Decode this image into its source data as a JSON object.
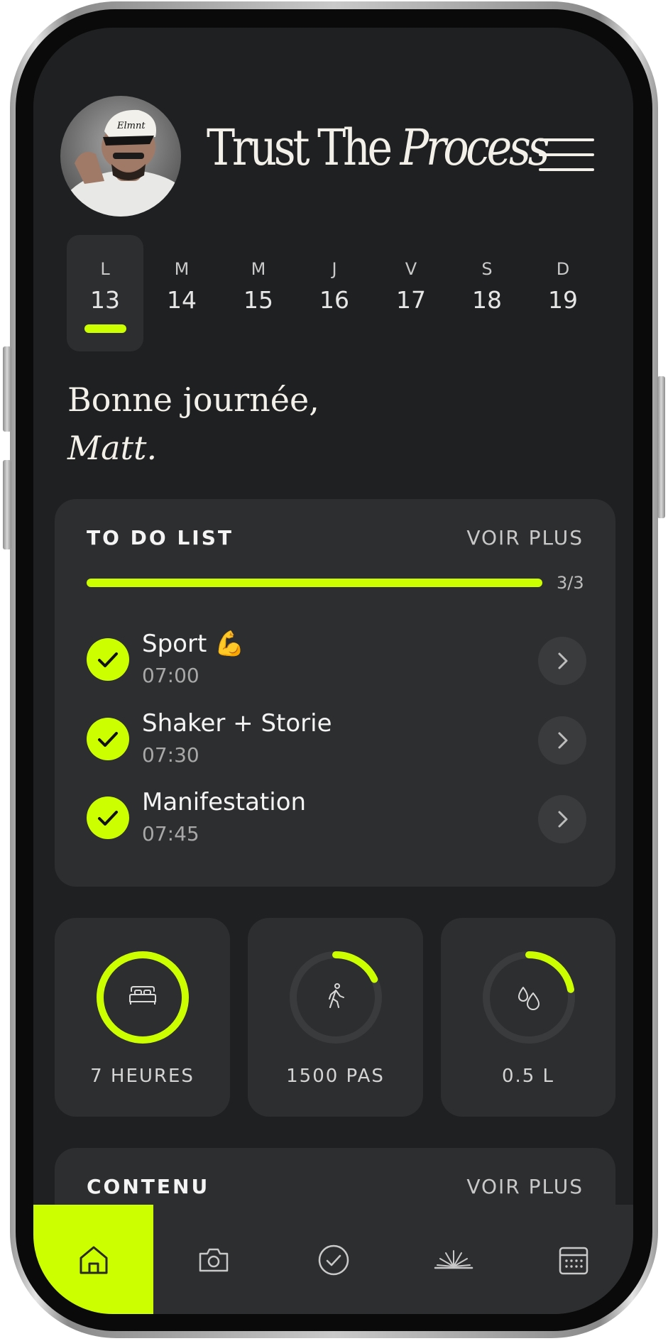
{
  "header": {
    "title_regular": "Trust The",
    "title_italic": "Process"
  },
  "calendar": {
    "days": [
      {
        "letter": "L",
        "number": "13",
        "selected": true
      },
      {
        "letter": "M",
        "number": "14"
      },
      {
        "letter": "M",
        "number": "15"
      },
      {
        "letter": "J",
        "number": "16"
      },
      {
        "letter": "V",
        "number": "17"
      },
      {
        "letter": "S",
        "number": "18"
      },
      {
        "letter": "D",
        "number": "19"
      }
    ]
  },
  "greeting": {
    "line1": "Bonne journée,",
    "name": "Matt."
  },
  "todo": {
    "title": "TO DO LIST",
    "see_more": "VOIR PLUS",
    "progress_fraction": 1.0,
    "progress_label": "3/3",
    "tasks": [
      {
        "name": "Sport 💪",
        "time": "07:00",
        "done": true
      },
      {
        "name": "Shaker + Storie",
        "time": "07:30",
        "done": true
      },
      {
        "name": "Manifestation",
        "time": "07:45",
        "done": true
      }
    ]
  },
  "stats": [
    {
      "icon": "bed-icon",
      "label": "7 HEURES",
      "progress_fraction": 1.0
    },
    {
      "icon": "walking-icon",
      "label": "1500 PAS",
      "progress_fraction": 0.18
    },
    {
      "icon": "water-drops-icon",
      "label": "0.5 L",
      "progress_fraction": 0.22
    }
  ],
  "content": {
    "title": "CONTENU",
    "see_more": "VOIR PLUS"
  },
  "tabbar": {
    "tabs": [
      {
        "icon": "home-icon",
        "active": true
      },
      {
        "icon": "camera-icon"
      },
      {
        "icon": "check-circle-icon"
      },
      {
        "icon": "sunrise-icon"
      },
      {
        "icon": "calendar-icon"
      }
    ]
  },
  "colors": {
    "accent": "#ccff00",
    "background": "#1f2022",
    "card": "#2d2e30",
    "text": "#f2f0e8"
  }
}
